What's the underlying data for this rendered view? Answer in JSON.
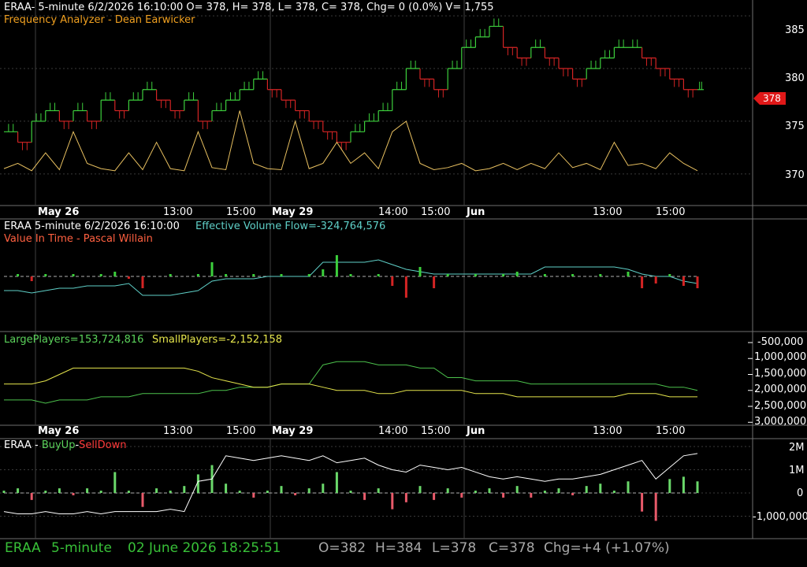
{
  "panel1": {
    "header": "ERAA- 5-minute 6/2/2026 16:10:00 O= 378, H= 378, L= 378, C= 378, Chg= 0 (0.0%) V= 1,755",
    "indicator": "Frequency Analyzer - Dean Earwicker",
    "last_price_tag": "378"
  },
  "panel2": {
    "header": "ERAA 5-minute  6/2/2026 16:10:00",
    "flow_label": "Effective Volume Flow=-324,764,576",
    "indicator": "Value In Time - Pascal Willain"
  },
  "panel3": {
    "large_label": "LargePlayers=153,724,816",
    "small_label": "SmallPlayers=-2,152,158"
  },
  "panel4": {
    "title_prefix": "ERAA - ",
    "buy_label": "BuyUp",
    "dash": "-",
    "sell_label": "SellDown"
  },
  "x_labels": [
    "May 26",
    "13:00",
    "15:00",
    "May 29",
    "14:00",
    "15:00",
    "Jun",
    "13:00",
    "15:00"
  ],
  "status": {
    "symbol": "ERAA",
    "interval": "5-minute",
    "datetime": "02 June 2026 18:25:51",
    "open": "O=382",
    "high": "H=384",
    "low": "L=378",
    "close": "C=378",
    "change": "Chg=+4 (+1.07%)"
  },
  "colors": {
    "up": "#3ccf3c",
    "down": "#d42424",
    "frequency": "#e8c060",
    "flow": "#5fd0c8",
    "large_players": "#4cc24c",
    "small_players": "#e6e64c",
    "buyup_line": "#ffffff",
    "grid": "#3a3a3a"
  },
  "chart_data": [
    {
      "type": "line",
      "name": "price",
      "y_ticks": [
        "385",
        "380",
        "375",
        "370"
      ],
      "ylim": [
        367,
        386.5
      ],
      "close": [
        374,
        373,
        375,
        376,
        375,
        376,
        375,
        377,
        376,
        377,
        378,
        377,
        376,
        377,
        375,
        376,
        377,
        378,
        379,
        378,
        377,
        376,
        375,
        374,
        373,
        374,
        375,
        376,
        378,
        380,
        379,
        378,
        380,
        382,
        383,
        384,
        382,
        381,
        382,
        381,
        380,
        379,
        380,
        381,
        382,
        382,
        381,
        380,
        379,
        378,
        378
      ],
      "frequency": [
        370.5,
        371,
        370.3,
        372,
        370.4,
        374,
        371,
        370.5,
        370.3,
        372,
        370.4,
        373,
        370.5,
        370.3,
        374,
        370.6,
        370.4,
        376,
        371,
        370.5,
        370.4,
        375,
        370.5,
        371,
        373,
        371,
        372,
        370.5,
        374,
        375,
        371,
        370.4,
        370.6,
        371,
        370.3,
        370.5,
        371,
        370.4,
        371,
        370.5,
        372,
        370.6,
        371,
        370.4,
        373,
        370.8,
        371,
        370.5,
        372,
        371,
        370.3
      ]
    },
    {
      "type": "line",
      "name": "effective-volume-flow",
      "values": [
        -0.6,
        -0.6,
        -0.7,
        -0.6,
        -0.5,
        -0.5,
        -0.4,
        -0.4,
        -0.4,
        -0.3,
        -0.8,
        -0.8,
        -0.8,
        -0.7,
        -0.6,
        -0.2,
        -0.1,
        -0.1,
        -0.1,
        0,
        0,
        0,
        0,
        0.6,
        0.6,
        0.6,
        0.6,
        0.7,
        0.5,
        0.3,
        0.2,
        0.1,
        0.1,
        0.1,
        0.1,
        0.1,
        0.1,
        0.1,
        0.1,
        0.4,
        0.4,
        0.4,
        0.4,
        0.4,
        0.4,
        0.3,
        0.1,
        0,
        0,
        -0.2,
        -0.3
      ],
      "bars": [
        0,
        0.1,
        -0.2,
        0.1,
        0,
        0.1,
        0,
        0.1,
        0.2,
        -0.1,
        -0.5,
        0,
        0.1,
        0,
        0.1,
        0.6,
        0.1,
        0,
        0.1,
        0,
        0.1,
        0,
        0.1,
        0.3,
        0.9,
        0.1,
        0,
        0.1,
        -0.4,
        -0.9,
        0.4,
        -0.5,
        0.1,
        0,
        0.1,
        0,
        0.1,
        0.2,
        0,
        0.1,
        0,
        0.1,
        0,
        0.1,
        0,
        0.2,
        -0.5,
        -0.3,
        0.1,
        -0.4,
        -0.5
      ]
    },
    {
      "type": "line",
      "name": "players",
      "y_ticks": [
        "-500,000",
        "1,000,000",
        "1,500,000",
        "2,000,000",
        "2,500,000",
        "3,000,000"
      ],
      "large": [
        2.3,
        2.3,
        2.3,
        2.4,
        2.3,
        2.3,
        2.3,
        2.2,
        2.2,
        2.2,
        2.1,
        2.1,
        2.1,
        2.1,
        2.1,
        2.0,
        2.0,
        1.9,
        1.9,
        1.9,
        1.8,
        1.8,
        1.8,
        1.2,
        1.1,
        1.1,
        1.1,
        1.2,
        1.2,
        1.2,
        1.3,
        1.3,
        1.6,
        1.6,
        1.7,
        1.7,
        1.7,
        1.7,
        1.8,
        1.8,
        1.8,
        1.8,
        1.8,
        1.8,
        1.8,
        1.8,
        1.8,
        1.8,
        1.9,
        1.9,
        2.0
      ],
      "small": [
        1.8,
        1.8,
        1.8,
        1.7,
        1.5,
        1.3,
        1.3,
        1.3,
        1.3,
        1.3,
        1.3,
        1.3,
        1.3,
        1.3,
        1.4,
        1.6,
        1.7,
        1.8,
        1.9,
        1.9,
        1.8,
        1.8,
        1.8,
        1.9,
        2.0,
        2.0,
        2.0,
        2.1,
        2.1,
        2.0,
        2.0,
        2.0,
        2.0,
        2.0,
        2.1,
        2.1,
        2.1,
        2.2,
        2.2,
        2.2,
        2.2,
        2.2,
        2.2,
        2.2,
        2.2,
        2.1,
        2.1,
        2.1,
        2.2,
        2.2,
        2.2
      ]
    },
    {
      "type": "bar",
      "name": "buyup-selldown",
      "y_ticks": [
        "2M",
        "1M",
        "0",
        "-1,000,000"
      ],
      "ylim": [
        -1.6,
        2.4
      ],
      "line": [
        -0.8,
        -0.9,
        -0.9,
        -0.8,
        -0.9,
        -0.9,
        -0.8,
        -0.9,
        -0.8,
        -0.8,
        -0.8,
        -0.8,
        -0.7,
        -0.8,
        0.5,
        0.6,
        1.6,
        1.5,
        1.4,
        1.5,
        1.6,
        1.5,
        1.4,
        1.6,
        1.3,
        1.4,
        1.5,
        1.2,
        1.0,
        0.9,
        1.2,
        1.1,
        1.0,
        1.1,
        0.9,
        0.7,
        0.6,
        0.7,
        0.6,
        0.5,
        0.6,
        0.6,
        0.7,
        0.8,
        1.0,
        1.2,
        1.4,
        0.6,
        1.1,
        1.6,
        1.7
      ],
      "values": [
        0.1,
        0.2,
        -0.3,
        0.1,
        0.2,
        -0.1,
        0.2,
        0.1,
        0.9,
        0.1,
        -0.6,
        0.2,
        0.1,
        0.3,
        0.8,
        1.2,
        0.4,
        0.1,
        -0.2,
        0.1,
        0.3,
        -0.1,
        0.2,
        0.4,
        0.9,
        0.1,
        -0.3,
        0.2,
        -0.7,
        -0.4,
        0.3,
        -0.3,
        0.2,
        -0.2,
        0.1,
        0.2,
        -0.2,
        0.3,
        -0.2,
        0.1,
        0.2,
        -0.1,
        0.3,
        0.4,
        0.1,
        0.5,
        -0.8,
        -1.2,
        0.6,
        0.7,
        0.5
      ]
    }
  ]
}
